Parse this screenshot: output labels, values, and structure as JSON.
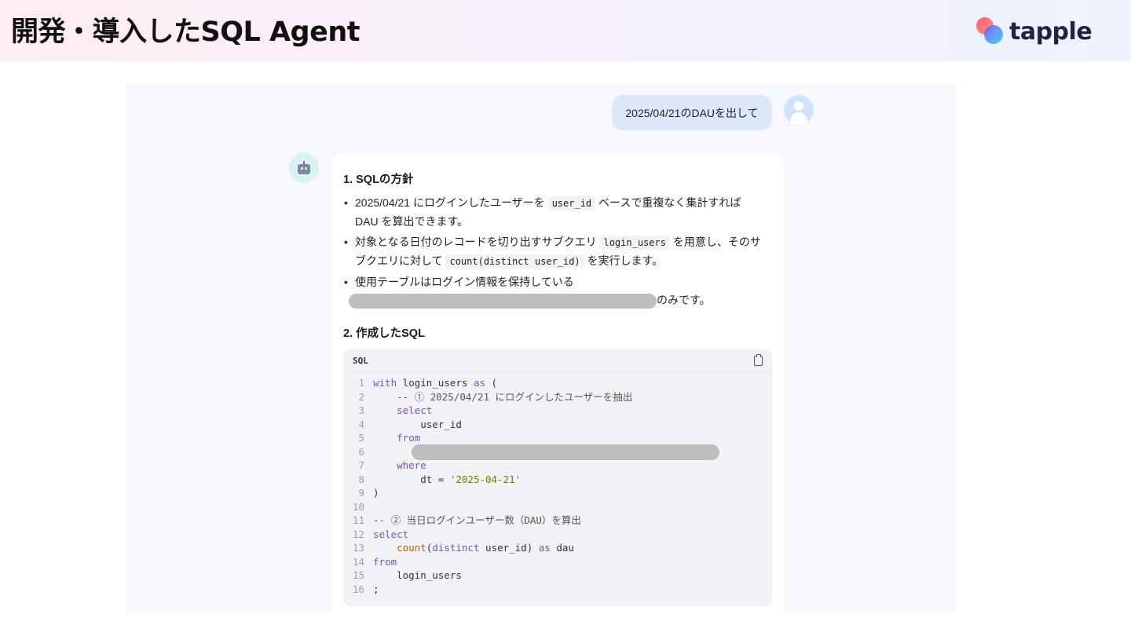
{
  "header": {
    "title": "開発・導入したSQL Agent",
    "logo_text": "tapple"
  },
  "chat": {
    "user_message": "2025/04/21のDAUを出して",
    "answer": {
      "heading1": "1. SQLの方針",
      "bullet1": {
        "text_a": "2025/04/21 にログインしたユーザーを",
        "code": "user_id",
        "text_b": "ベースで重複なく集計すれば DAU を算出できます。"
      },
      "bullet2": {
        "text_a": "対象となる日付のレコードを切り出すサブクエリ",
        "code": "login_users",
        "text_b": "を用意し、そのサブクエリに対して",
        "code2": "count(distinct user_id)",
        "text_c": "を実行します。"
      },
      "bullet3": {
        "text_a": "使用テーブルはログイン情報を保持している",
        "text_b": "のみです。"
      },
      "heading2": "2. 作成したSQL",
      "code_block": {
        "language": "SQL",
        "lines": [
          {
            "n": "1",
            "t": "with login_users as ("
          },
          {
            "n": "2",
            "t": "    -- ① 2025/04/21 にログインしたユーザーを抽出"
          },
          {
            "n": "3",
            "t": "    select"
          },
          {
            "n": "4",
            "t": "        user_id"
          },
          {
            "n": "5",
            "t": "    from"
          },
          {
            "n": "6",
            "t": ""
          },
          {
            "n": "7",
            "t": "    where"
          },
          {
            "n": "8",
            "t": "        dt = '2025-04-21'"
          },
          {
            "n": "9",
            "t": ")"
          },
          {
            "n": "10",
            "t": ""
          },
          {
            "n": "11",
            "t": "-- ② 当日ログインユーザー数（DAU）を算出"
          },
          {
            "n": "12",
            "t": "select"
          },
          {
            "n": "13",
            "t": "    count(distinct user_id) as dau"
          },
          {
            "n": "14",
            "t": "from"
          },
          {
            "n": "15",
            "t": "    login_users"
          },
          {
            "n": "16",
            "t": ";"
          }
        ]
      }
    }
  }
}
